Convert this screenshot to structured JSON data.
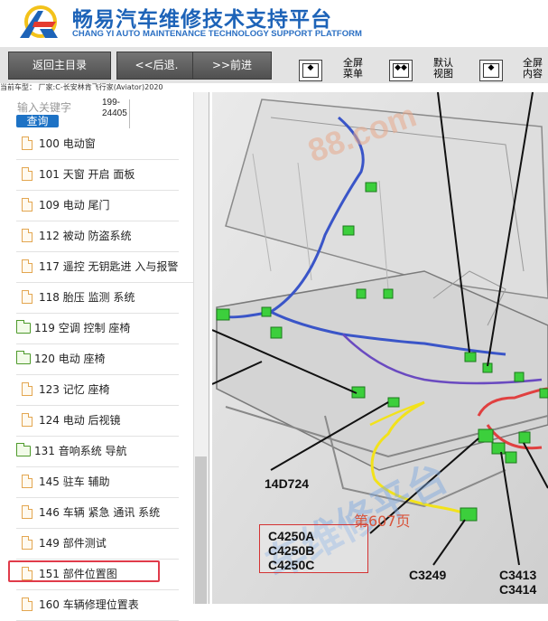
{
  "header": {
    "brand_cn": "畅易汽车维修技术支持平台",
    "brand_en": "CHANG YI AUTO MAINTENANCE TECHNOLOGY SUPPORT PLATFORM"
  },
  "toolbar": {
    "back_home": "返回主目录",
    "back": "<<后退.",
    "forward": ">>前进",
    "full_menu": [
      "全屏",
      "菜单"
    ],
    "default_view": [
      "默认",
      "视图"
    ],
    "full_content": [
      "全屏",
      "内容"
    ]
  },
  "breadcrumb": "当前车型： 厂家:C-长安林肯飞行家(Aviator)2020",
  "search": {
    "placeholder": "输入关键字",
    "button": "查询",
    "value_line1": "199-",
    "value_line2": "24405"
  },
  "menu": [
    {
      "label": "100 电动窗",
      "type": "doc"
    },
    {
      "label": "101 天窗 开启 面板",
      "type": "doc"
    },
    {
      "label": "109 电动 尾门",
      "type": "doc"
    },
    {
      "label": "112 被动 防盗系统",
      "type": "doc"
    },
    {
      "label": "117 遥控 无钥匙进 入与报警",
      "type": "doc"
    },
    {
      "label": "118 胎压 监测 系统",
      "type": "doc"
    },
    {
      "label": "119 空调 控制 座椅",
      "type": "folder"
    },
    {
      "label": "120 电动 座椅",
      "type": "folder"
    },
    {
      "label": "123 记忆 座椅",
      "type": "doc"
    },
    {
      "label": "124 电动 后视镜",
      "type": "doc"
    },
    {
      "label": "131 音响系统 导航",
      "type": "folder"
    },
    {
      "label": "145 驻车 辅助",
      "type": "doc"
    },
    {
      "label": "146 车辆 紧急 通讯 系统",
      "type": "doc"
    },
    {
      "label": "149 部件测试",
      "type": "doc"
    },
    {
      "label": "151 部件位置图",
      "type": "doc"
    },
    {
      "label": "160 车辆修理位置表",
      "type": "doc"
    }
  ],
  "diagram": {
    "watermark_url": "88.com",
    "watermark_cn": "车维修平台",
    "label_14d724": "14D724",
    "label_c3249": "C3249",
    "label_c3413": "C3413",
    "label_c3414": "C3414",
    "page_number": "第607页",
    "box_lines": [
      "C4250A",
      "C4250B",
      "C4250C"
    ]
  },
  "colors": {
    "brand_blue": "#1d63b8",
    "highlight_red": "#e03b4a",
    "connector_green": "#3ccf3c",
    "wire_blue": "#3a55c8",
    "wire_red": "#e04040",
    "wire_yellow": "#f2e21b"
  }
}
